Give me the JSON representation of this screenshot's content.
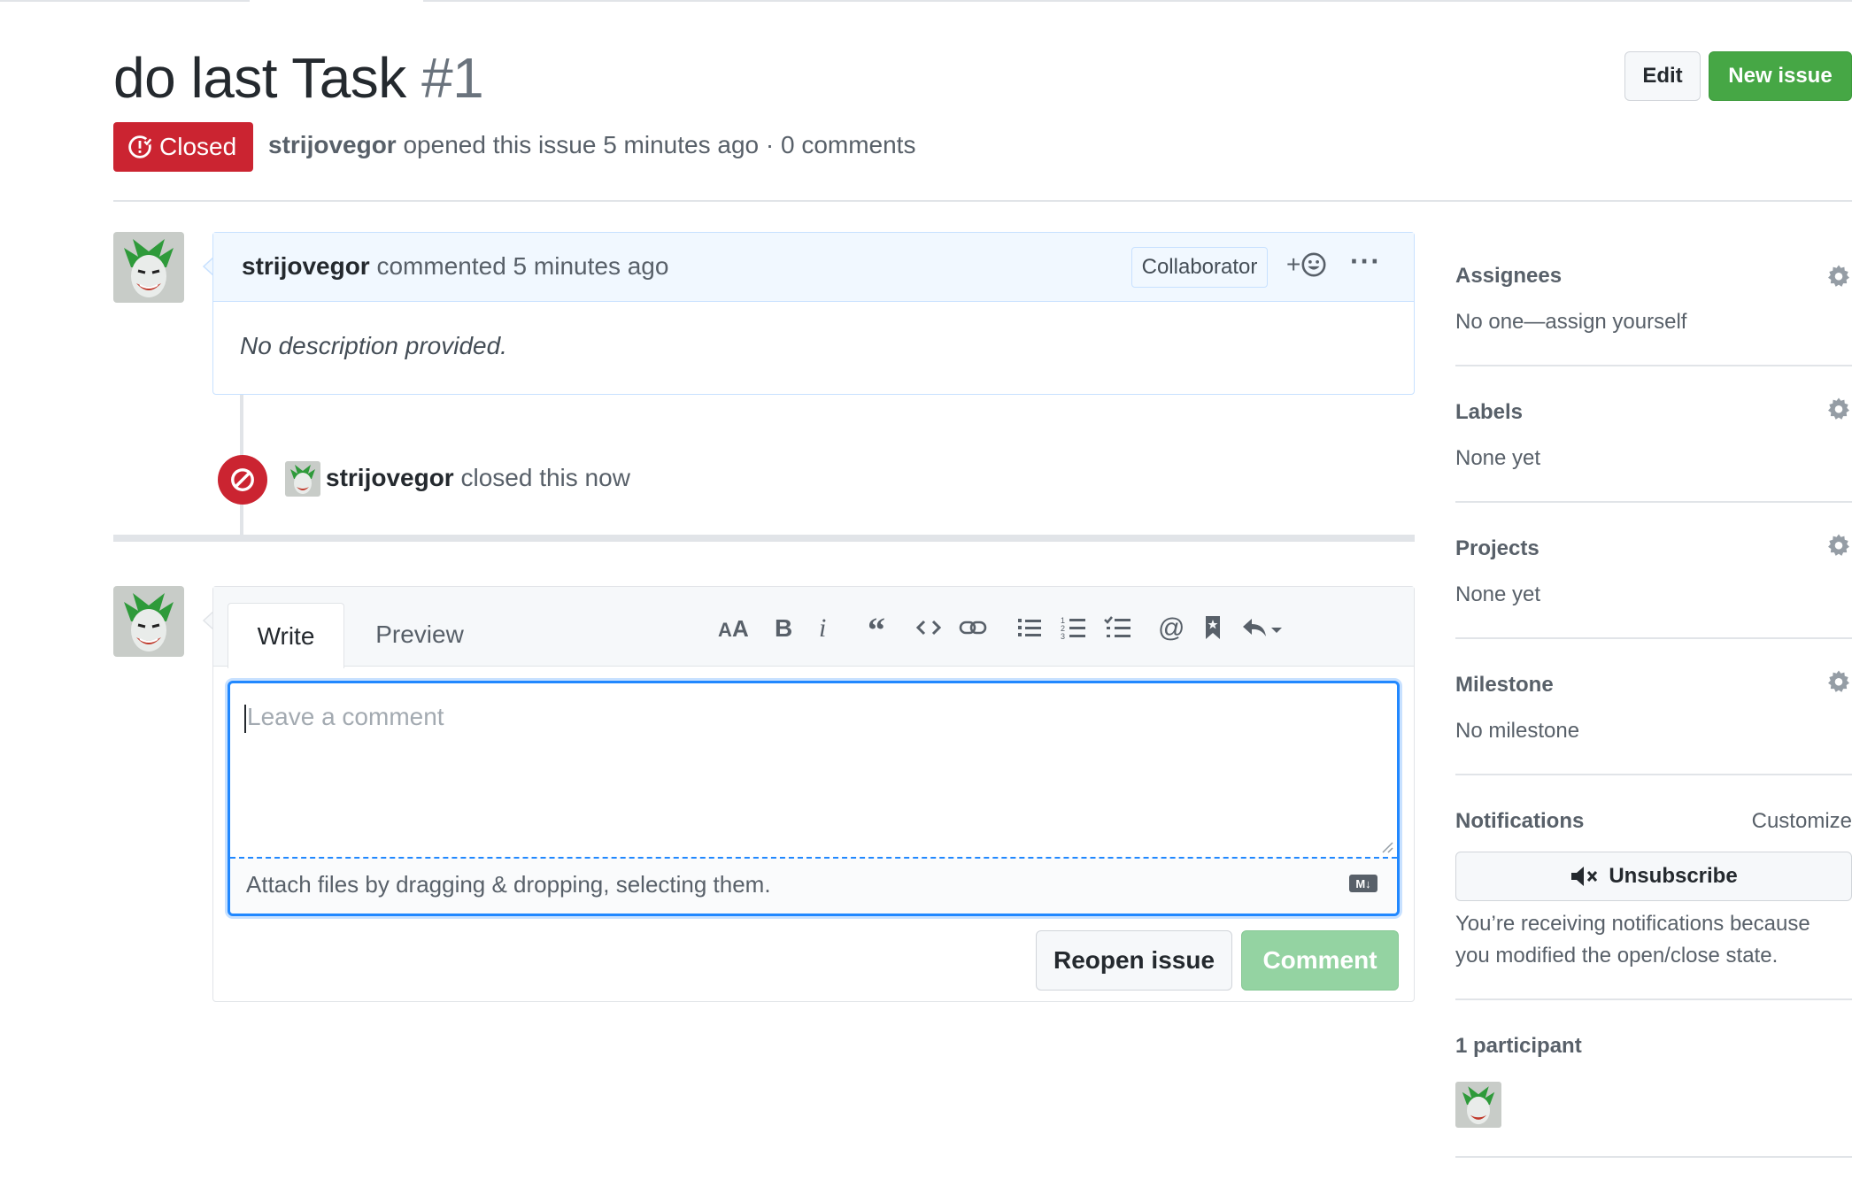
{
  "issue": {
    "title": "do last Task",
    "number": "#1",
    "state": "Closed",
    "author": "strijovegor",
    "meta_text": "opened this issue 5 minutes ago · 0 comments"
  },
  "header_buttons": {
    "edit": "Edit",
    "new_issue": "New issue"
  },
  "comment": {
    "author": "strijovegor",
    "action": "commented 5 minutes ago",
    "role_badge": "Collaborator",
    "reaction_label": "+",
    "more_label": "···",
    "body": "No description provided."
  },
  "event": {
    "actor": "strijovegor",
    "text": "closed this now"
  },
  "composer": {
    "tabs": [
      "Write",
      "Preview"
    ],
    "placeholder": "Leave a comment",
    "attach_text": "Attach files by dragging & dropping, selecting them.",
    "markdown_badge": "M↓",
    "reopen_button": "Reopen issue",
    "comment_button": "Comment",
    "toolbar": [
      "header-icon",
      "bold-icon",
      "italic-icon",
      "quote-icon",
      "code-icon",
      "link-icon",
      "bulleted-list-icon",
      "numbered-list-icon",
      "task-list-icon",
      "mention-icon",
      "reference-icon",
      "reply-icon"
    ]
  },
  "sidebar": {
    "assignees": {
      "title": "Assignees",
      "value": "No one—assign yourself"
    },
    "labels": {
      "title": "Labels",
      "value": "None yet"
    },
    "projects": {
      "title": "Projects",
      "value": "None yet"
    },
    "milestone": {
      "title": "Milestone",
      "value": "No milestone"
    },
    "notifications": {
      "title": "Notifications",
      "customize": "Customize",
      "button": "Unsubscribe",
      "reason": "You’re receiving notifications because you modified the open/close state."
    },
    "participants": {
      "title": "1 participant"
    }
  },
  "colors": {
    "closed_red": "#cb2431",
    "green": "#46a745",
    "focus_blue": "#2188ff"
  }
}
